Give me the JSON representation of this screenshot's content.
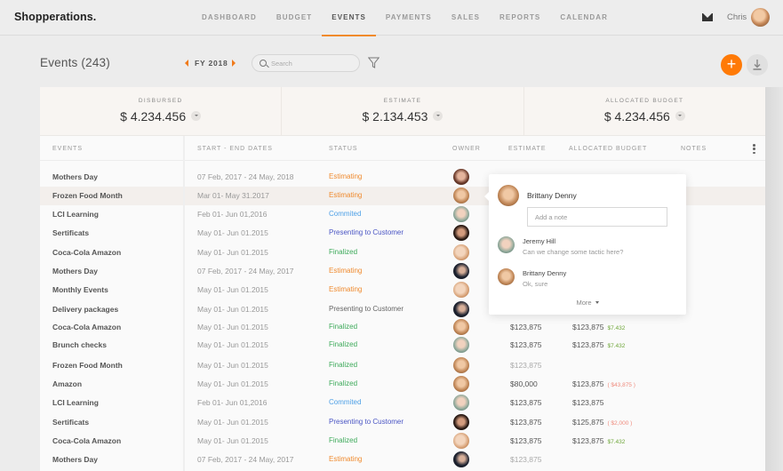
{
  "app": {
    "brand": "Shopperations.",
    "nav": [
      {
        "label": "DASHBOARD",
        "active": false
      },
      {
        "label": "BUDGET",
        "active": false
      },
      {
        "label": "EVENTS",
        "active": true
      },
      {
        "label": "PAYMENTS",
        "active": false
      },
      {
        "label": "SALES",
        "active": false
      },
      {
        "label": "REPORTS",
        "active": false
      },
      {
        "label": "CALENDAR",
        "active": false
      }
    ],
    "user": {
      "name": "Chris",
      "mail_icon": "mail-icon"
    }
  },
  "toolbar": {
    "title": "Events (243)",
    "fiscal_year": "FY 2018",
    "search_placeholder": "Search",
    "search_value": "",
    "filter_icon": "filter-icon",
    "add_icon": "plus-icon",
    "add_symbol": "+",
    "download_icon": "download-icon",
    "accent_color": "#ff7a06"
  },
  "summary": [
    {
      "label": "DISBURSED",
      "value": "$ 4.234.456"
    },
    {
      "label": "ESTIMATE",
      "value": "$ 2.134.453"
    },
    {
      "label": "ALLOCATED BUDGET",
      "value": "$ 4.234.456"
    }
  ],
  "table": {
    "columns": [
      "EVENTS",
      "START - END DATES",
      "STATUS",
      "OWNER",
      "ESTIMATE",
      "ALLOCATED BUDGET",
      "NOTES"
    ],
    "rows": [
      {
        "name": "Mothers Day",
        "dates": "07 Feb, 2017 - 24 May, 2018",
        "status": "Estimating",
        "status_kind": "estimating",
        "owner": "a",
        "estimate": "",
        "allocated": "",
        "diff": "",
        "diff_kind": ""
      },
      {
        "name": "Frozen Food Month",
        "dates": "Mar 01- May 31.2017",
        "status": "Estimating",
        "status_kind": "estimating",
        "owner": "b",
        "estimate": "",
        "allocated": "",
        "diff": "",
        "diff_kind": "",
        "highlighted": true
      },
      {
        "name": "LCI Learning",
        "dates": "Feb 01- Jun 01,2016",
        "status": "Commited",
        "status_kind": "commited",
        "owner": "c",
        "estimate": "",
        "allocated": "",
        "diff": "",
        "diff_kind": ""
      },
      {
        "name": "Sertificats",
        "dates": "May 01- Jun 01.2015",
        "status": "Presenting to Customer",
        "status_kind": "presenting",
        "owner": "d",
        "estimate": "",
        "allocated": "",
        "diff": "",
        "diff_kind": ""
      },
      {
        "name": "Coca-Cola Amazon",
        "dates": "May 01- Jun 01.2015",
        "status": "Finalized",
        "status_kind": "finalized",
        "owner": "e",
        "estimate": "",
        "allocated": "",
        "diff": "",
        "diff_kind": ""
      },
      {
        "name": "Mothers Day",
        "dates": "07 Feb, 2017 - 24 May, 2017",
        "status": "Estimating",
        "status_kind": "estimating",
        "owner": "f",
        "estimate": "",
        "allocated": "",
        "diff": "",
        "diff_kind": ""
      },
      {
        "name": "Monthly Events",
        "dates": "May 01- Jun 01.2015",
        "status": "Estimating",
        "status_kind": "estimating",
        "owner": "e",
        "estimate": "",
        "allocated": "",
        "diff": "",
        "diff_kind": ""
      },
      {
        "name": "Delivery packages",
        "dates": "May 01- Jun 01.2015",
        "status": "Presenting to Customer",
        "status_kind": "presenting-gray",
        "owner": "f",
        "estimate": "",
        "allocated": "",
        "diff": "",
        "diff_kind": ""
      },
      {
        "name": "Coca-Cola Amazon",
        "dates": "May 01- Jun 01.2015",
        "status": "Finalized",
        "status_kind": "finalized",
        "owner": "b",
        "estimate": "$123,875",
        "allocated": "$123,875",
        "diff": "$7.432",
        "diff_kind": "pos"
      },
      {
        "name": "Brunch checks",
        "dates": "May 01- Jun 01.2015",
        "status": "Finalized",
        "status_kind": "finalized",
        "owner": "c",
        "estimate": "$123,875",
        "allocated": "$123,875",
        "diff": "$7.432",
        "diff_kind": "pos"
      },
      {
        "name": "Frozen Food Month",
        "dates": "May 01- Jun 01.2015",
        "status": "Finalized",
        "status_kind": "finalized",
        "owner": "b",
        "estimate": "$123,875",
        "estimate_muted": true,
        "allocated": "",
        "diff": "",
        "diff_kind": ""
      },
      {
        "name": "Amazon",
        "dates": "May 01- Jun 01.2015",
        "status": "Finalized",
        "status_kind": "finalized",
        "owner": "b",
        "estimate": "$80,000",
        "allocated": "$123,875",
        "diff": "( $43,875 )",
        "diff_kind": "neg"
      },
      {
        "name": "LCI Learning",
        "dates": "Feb 01- Jun 01,2016",
        "status": "Commited",
        "status_kind": "commited",
        "owner": "c",
        "estimate": "$123,875",
        "allocated": "$123,875",
        "diff": "",
        "diff_kind": ""
      },
      {
        "name": "Sertificats",
        "dates": "May 01- Jun 01.2015",
        "status": "Presenting to Customer",
        "status_kind": "presenting",
        "owner": "d",
        "estimate": "$123,875",
        "allocated": "$125,875",
        "diff": "( $2,000 )",
        "diff_kind": "neg"
      },
      {
        "name": "Coca-Cola Amazon",
        "dates": "May 01- Jun 01.2015",
        "status": "Finalized",
        "status_kind": "finalized",
        "owner": "e",
        "estimate": "$123,875",
        "allocated": "$123,875",
        "diff": "$7.432",
        "diff_kind": "pos"
      },
      {
        "name": "Mothers Day",
        "dates": "07 Feb, 2017 - 24 May, 2017",
        "status": "Estimating",
        "status_kind": "estimating",
        "owner": "f",
        "estimate": "$123,875",
        "estimate_muted": true,
        "allocated": "",
        "diff": "",
        "diff_kind": ""
      }
    ]
  },
  "notes_popover": {
    "author": "Brittany Denny",
    "input_placeholder": "Add a note",
    "input_value": "",
    "comments": [
      {
        "author": "Jeremy Hill",
        "text": "Can we change some tactic here?",
        "avatar": "c"
      },
      {
        "author": "Brittany Denny",
        "text": "Ok, sure",
        "avatar": "b"
      }
    ],
    "more_label": "More"
  }
}
